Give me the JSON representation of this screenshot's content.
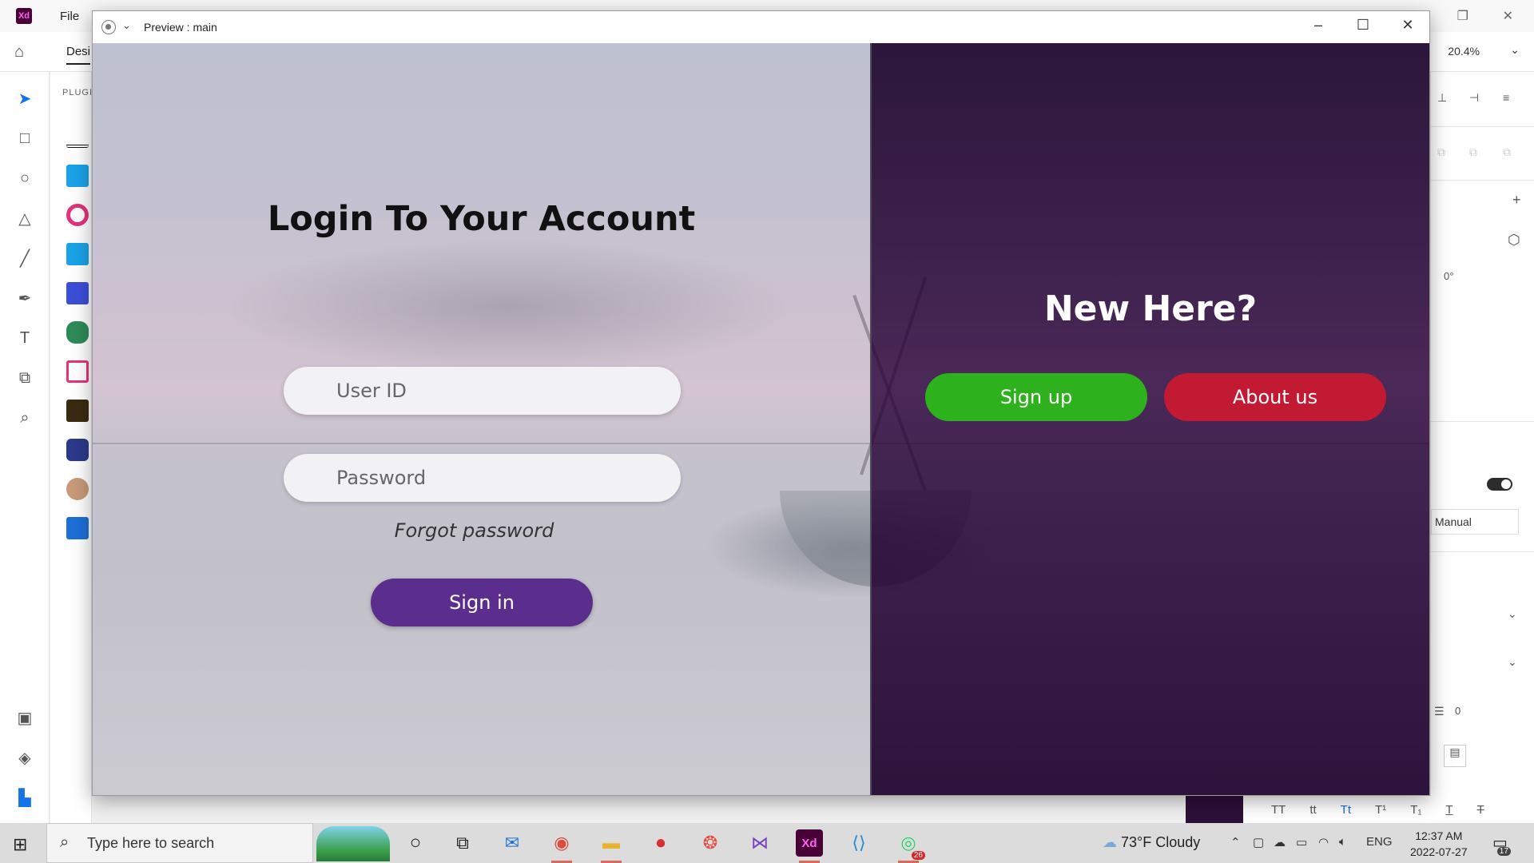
{
  "xd": {
    "menu_file": "File",
    "tab_design": "Desi",
    "zoom": "20.4%",
    "plugins_label": "PLUGI",
    "rotation": "0°",
    "height_mode": "Manual",
    "spacing_value": "0",
    "text_styles": [
      "TT",
      "tt",
      "Tt",
      "T¹",
      "T₁",
      "T",
      "T"
    ]
  },
  "preview": {
    "title": "Preview : main",
    "login": {
      "heading": "Login To Your Account",
      "user_placeholder": "User ID",
      "password_placeholder": "Password",
      "forgot": "Forgot password",
      "sign_in": "Sign in"
    },
    "register": {
      "heading": "New Here?",
      "sign_up": "Sign up",
      "about_us": "About us"
    },
    "colors": {
      "sign_in": "#5b2d8c",
      "sign_up": "#2db11c",
      "about_us": "#c21a32",
      "panel": "#2a0c3a"
    }
  },
  "taskbar": {
    "search_placeholder": "Type here to search",
    "weather": "73°F  Cloudy",
    "language": "ENG",
    "time": "12:37 AM",
    "date": "2022-07-27",
    "whatsapp_badge": "26",
    "notification_count": "17",
    "xd_app_label": "Xd"
  }
}
